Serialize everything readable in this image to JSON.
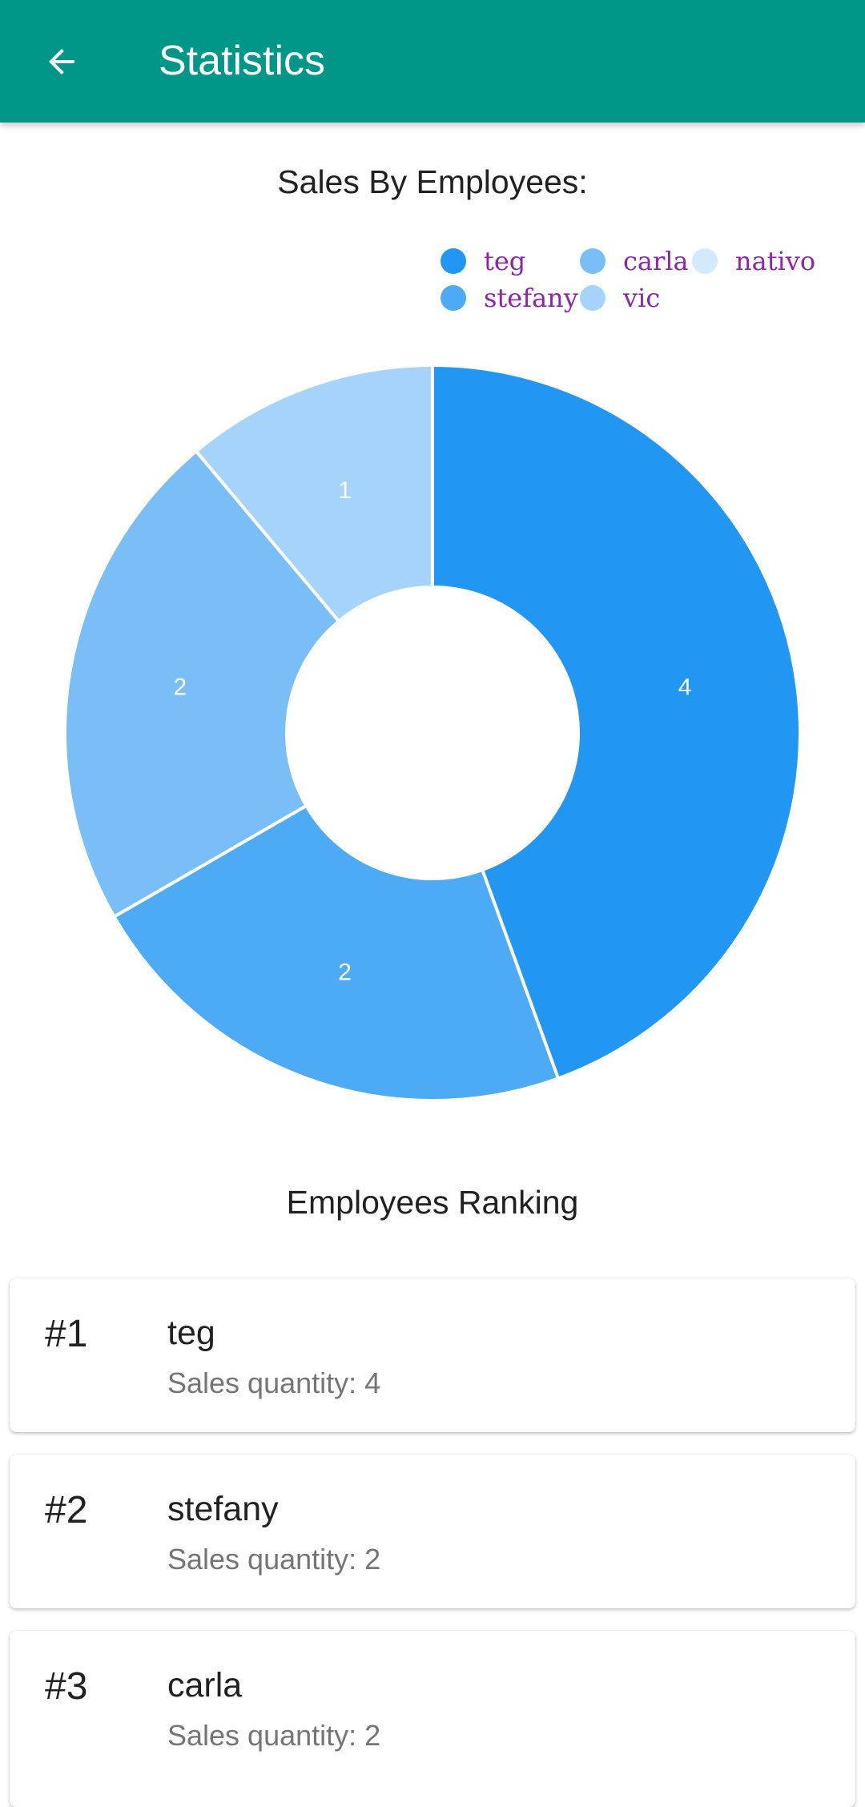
{
  "app_bar": {
    "title": "Statistics",
    "back_icon": "arrow-back-icon",
    "color": "#009688"
  },
  "chart_section": {
    "title": "Sales By Employees:"
  },
  "chart_data": {
    "type": "pie",
    "style": "donut",
    "title": "Sales By Employees:",
    "legend_placement": "top-right",
    "categories": [
      "teg",
      "stefany",
      "carla",
      "vic",
      "nativo"
    ],
    "values": [
      4,
      2,
      2,
      1,
      0
    ],
    "colors": [
      "#2196F3",
      "#4DAAF5",
      "#7ABEF8",
      "#A6D3F9",
      "#D3E9FC"
    ]
  },
  "ranking_section": {
    "title": "Employees Ranking",
    "items": [
      {
        "rank": "#1",
        "name": "teg",
        "sales": "Sales quantity: 4"
      },
      {
        "rank": "#2",
        "name": "stefany",
        "sales": "Sales quantity: 2"
      },
      {
        "rank": "#3",
        "name": "carla",
        "sales": "Sales quantity: 2"
      }
    ]
  }
}
